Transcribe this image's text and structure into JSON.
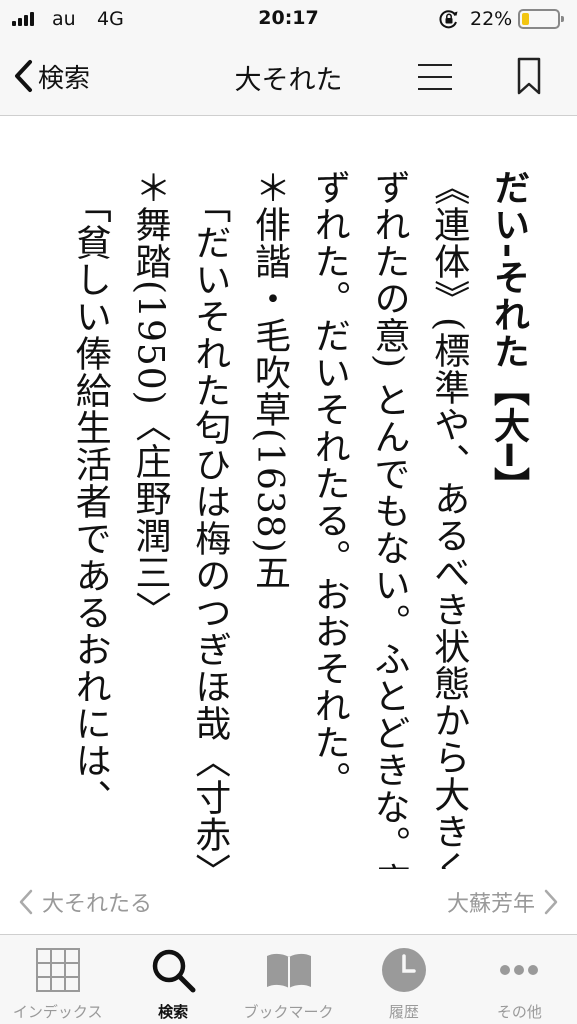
{
  "status_bar": {
    "carrier": "au",
    "network": "4G",
    "time": "20:17",
    "battery_percent": "22%",
    "battery_level": 0.22,
    "battery_color": "#f2c511"
  },
  "nav": {
    "back_label": "検索",
    "title": "大それた",
    "menu_icon": "hamburger-icon",
    "bookmark_icon": "bookmark-icon"
  },
  "entry": {
    "headword": "だい‐それた",
    "kanji": "【大━】",
    "lines": [
      "《連体》(標準や、あるべき状態から大きくはずれたの意) とんでもない。ふとどきな。度はずれた。だいそれたる。おおそれた。",
      "＊俳諧・毛吹草(1638)五",
      "「だいそれた匂ひは梅のつぎほ哉〈寸赤〉」",
      "＊舞踏(1950)〈庄野潤三〉",
      "「貧しい俸給生活者であるおれには、"
    ]
  },
  "entry_nav": {
    "prev": "大それたる",
    "next": "大蘇芳年"
  },
  "tabs": [
    {
      "label": "インデックス",
      "icon": "grid-icon",
      "active": false
    },
    {
      "label": "検索",
      "icon": "search-icon",
      "active": true
    },
    {
      "label": "ブックマーク",
      "icon": "book-icon",
      "active": false
    },
    {
      "label": "履歴",
      "icon": "clock-icon",
      "active": false
    },
    {
      "label": "その他",
      "icon": "more-icon",
      "active": false
    }
  ],
  "colors": {
    "bar_background": "#f7f7f7",
    "inactive": "#9a9a9a",
    "active": "#111111"
  }
}
